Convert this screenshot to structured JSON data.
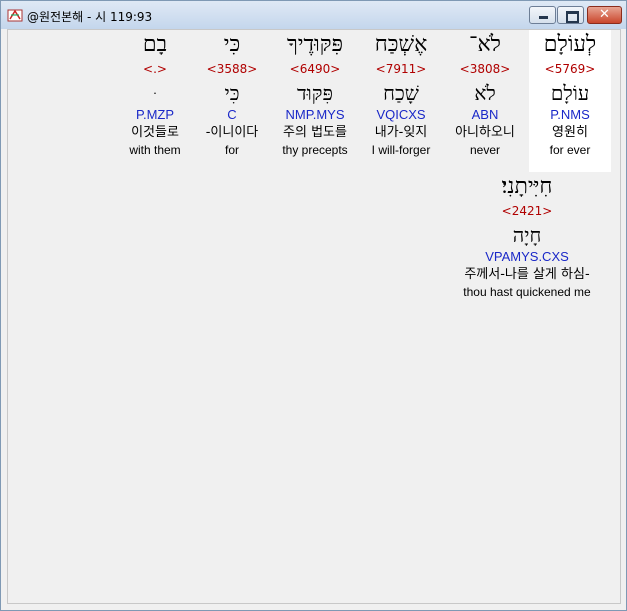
{
  "window": {
    "title": "@원전본해 - 시 119:93"
  },
  "words": [
    {
      "hebrew": "לְעוֹלָם",
      "strong": "<5769>",
      "lemma": "עוֹלָם",
      "morph": "P.NMS",
      "korean": "영원히",
      "english": "for ever"
    },
    {
      "hebrew": "לֹא־",
      "strong": "<3808>",
      "lemma": "לֹא",
      "morph": "ABN",
      "korean": "아니하오니",
      "english": "never"
    },
    {
      "hebrew": "אֶשְׁכַּח",
      "strong": "<7911>",
      "lemma": "שָׁכַח",
      "morph": "VQICXS",
      "korean": "내가-잊지",
      "english": "I will-forger"
    },
    {
      "hebrew": "פִּקּוּדֶיךָ",
      "strong": "<6490>",
      "lemma": "פִּקּוּד",
      "morph": "NMP.MYS",
      "korean": "주의 법도를",
      "english": "thy precepts"
    },
    {
      "hebrew": "כִּי",
      "strong": "<3588>",
      "lemma": "כִּי",
      "morph": "C",
      "korean": "-이니이다",
      "english": "for"
    },
    {
      "hebrew": "בָם",
      "strong": "<.>",
      "lemma": "ּ",
      "morph": "P.MZP",
      "korean": "이것들로",
      "english": "with them"
    },
    {
      "hebrew": "חִיִּיתָנִי׃",
      "strong": "<2421>",
      "lemma": "חָיָה",
      "morph": "VPAMYS.CXS",
      "korean": "주께서-나를 살게 하심-",
      "english": "thou hast quickened me"
    }
  ]
}
